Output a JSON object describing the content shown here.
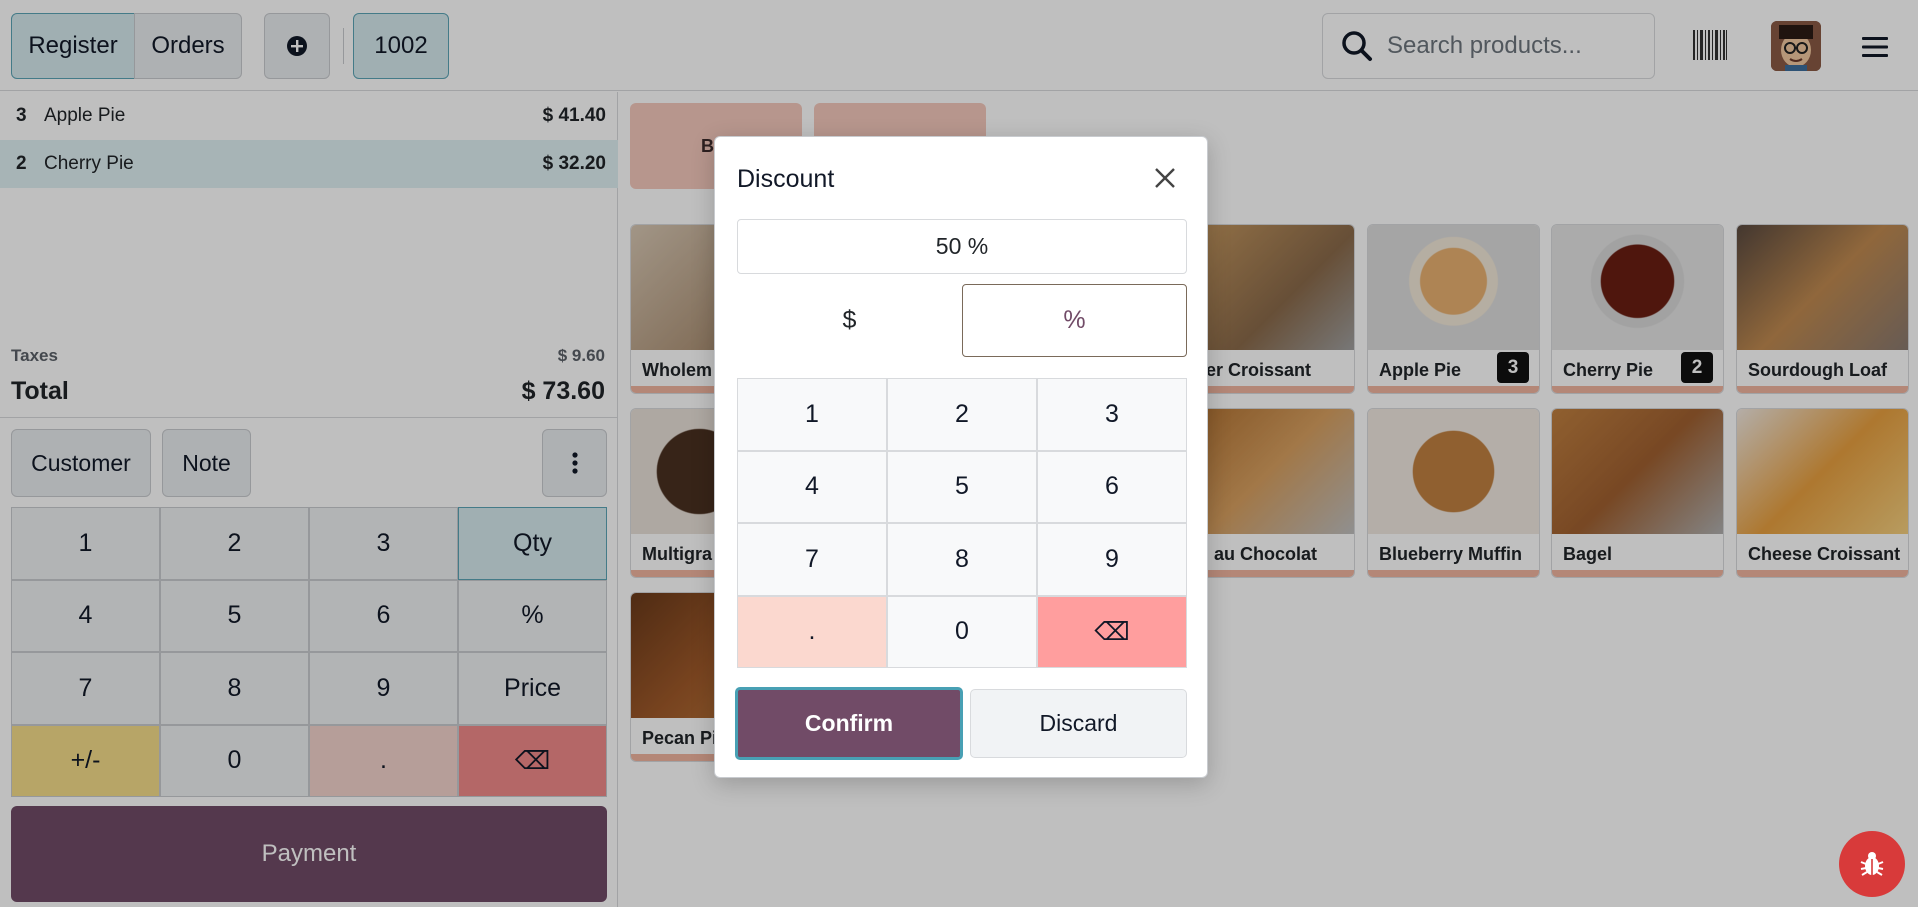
{
  "topbar": {
    "register_label": "Register",
    "orders_label": "Orders",
    "add_icon": "plus-circle-icon",
    "order_number": "1002",
    "search_placeholder": "Search products...",
    "search_icon": "search-icon",
    "barcode_icon": "barcode-icon",
    "menu_icon": "hamburger-menu-icon"
  },
  "order": {
    "lines": [
      {
        "qty": "3",
        "name": "Apple Pie",
        "price": "$ 41.40",
        "selected": false
      },
      {
        "qty": "2",
        "name": "Cherry Pie",
        "price": "$ 32.20",
        "selected": true
      }
    ],
    "taxes_label": "Taxes",
    "taxes_value": "$ 9.60",
    "total_label": "Total",
    "total_value": "$ 73.60"
  },
  "actions": {
    "customer_label": "Customer",
    "note_label": "Note",
    "more_icon": "vertical-dots-icon"
  },
  "numpad": {
    "keys": [
      "1",
      "2",
      "3",
      "Qty",
      "4",
      "5",
      "6",
      "%",
      "7",
      "8",
      "9",
      "Price",
      "+/-",
      "0",
      ".",
      "⌫"
    ],
    "active_mode": "Qty"
  },
  "payment_label": "Payment",
  "categories": [
    {
      "label": "Bre",
      "color": "#f5c9bd"
    },
    {
      "label": "",
      "color": "#f5c9bd"
    }
  ],
  "products": [
    {
      "name": "Wholem",
      "badge": ""
    },
    {
      "name": "utter Croissant",
      "badge": ""
    },
    {
      "name": "Apple Pie",
      "badge": "3"
    },
    {
      "name": "Cherry Pie",
      "badge": "2"
    },
    {
      "name": "Sourdough Loaf",
      "badge": ""
    },
    {
      "name": "Multigra",
      "badge": ""
    },
    {
      "name": "ain au Chocolat",
      "badge": ""
    },
    {
      "name": "Blueberry Muffin",
      "badge": ""
    },
    {
      "name": "Bagel",
      "badge": ""
    },
    {
      "name": "Cheese Croissant",
      "badge": ""
    },
    {
      "name": "Pecan Pi",
      "badge": ""
    }
  ],
  "dialog": {
    "title": "Discount",
    "value": "50 %",
    "mode_dollar": "$",
    "mode_percent": "%",
    "keys": [
      "1",
      "2",
      "3",
      "4",
      "5",
      "6",
      "7",
      "8",
      "9",
      ".",
      "0",
      "⌫"
    ],
    "confirm_label": "Confirm",
    "discard_label": "Discard",
    "close_icon": "close-icon"
  },
  "debug_icon": "bug-icon",
  "colors": {
    "primary": "#714b67",
    "active_blue": "#d6eaee",
    "backspace": "#f08a8a",
    "plusminus": "#f5dd8a"
  }
}
